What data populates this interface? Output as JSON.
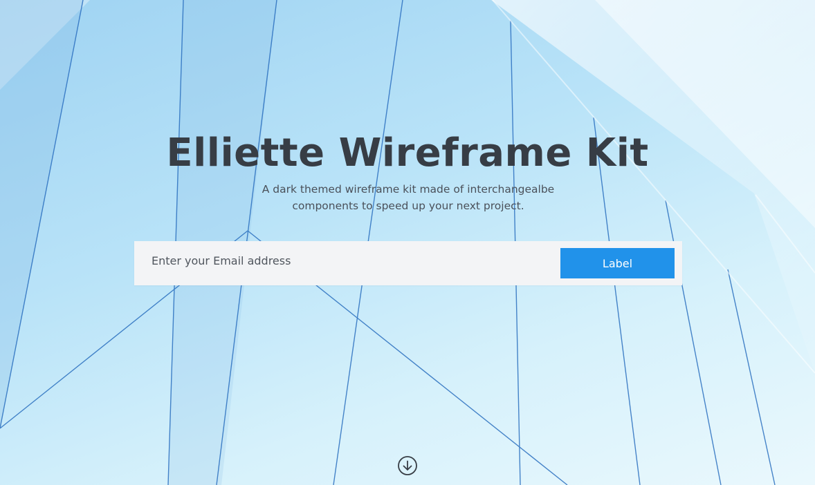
{
  "hero": {
    "title": "Elliette Wireframe Kit",
    "subtitle_line1": "A dark themed wireframe kit made of interchangealbe",
    "subtitle_line2": "components to speed up your next project."
  },
  "signup": {
    "email_placeholder": "Enter your Email address",
    "email_value": "",
    "button_label": "Label"
  },
  "scroll": {
    "icon": "arrow-down-circle-icon"
  },
  "colors": {
    "title": "#373d45",
    "button": "#2192ea",
    "form_background": "#f3f4f6"
  }
}
